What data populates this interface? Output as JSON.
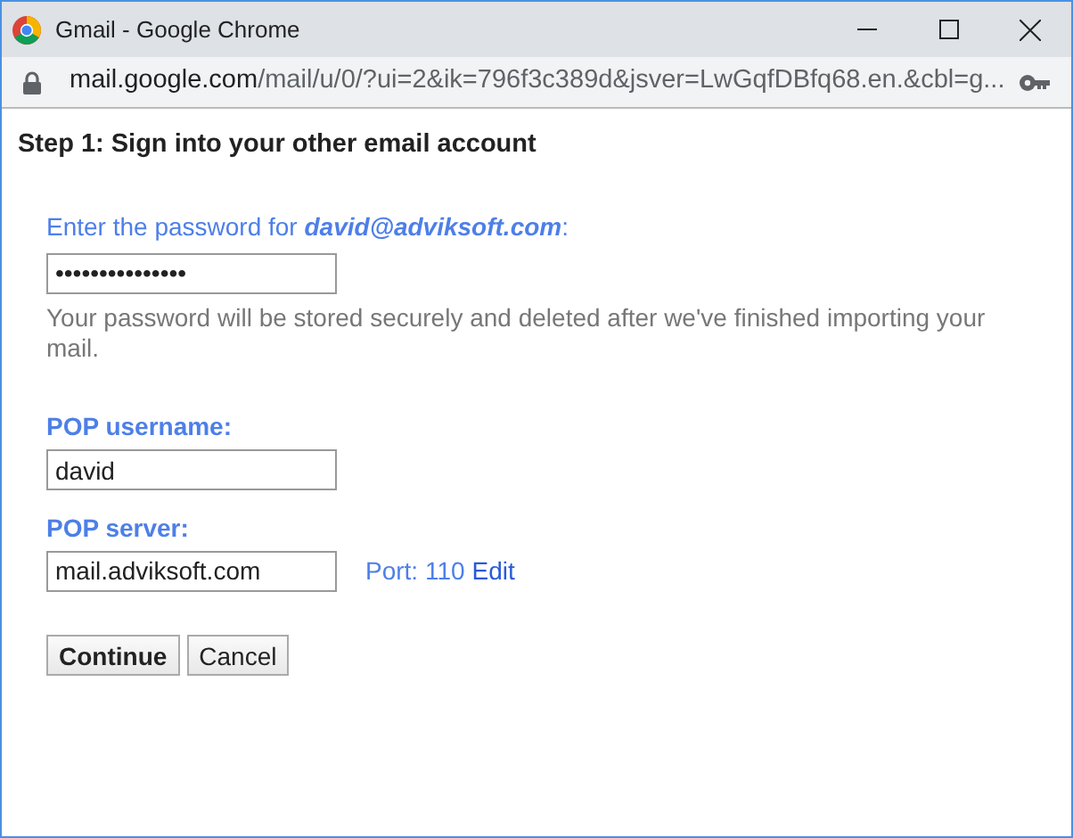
{
  "window": {
    "title": "Gmail - Google Chrome"
  },
  "address_bar": {
    "host": "mail.google.com",
    "path": "/mail/u/0/?ui=2&ik=796f3c389d&jsver=LwGqfDBfq68.en.&cbl=g..."
  },
  "heading": "Step 1: Sign into your other email account",
  "password_prompt": "Enter the password for **david@adviksoft.com**:",
  "password_field": {
    "value": "•••••••••••••••"
  },
  "password_note": "Your password will be stored securely and deleted after we've finished importing your mail.",
  "username": {
    "label": "POP username:",
    "value": "david"
  },
  "server": {
    "label": "POP server:",
    "value": "mail.adviksoft.com",
    "port": "Port: 110",
    "edit_link": "Edit"
  },
  "buttons": [
    {
      "label": "Continue",
      "primary": true
    },
    {
      "label": "Cancel",
      "primary": false
    }
  ]
}
